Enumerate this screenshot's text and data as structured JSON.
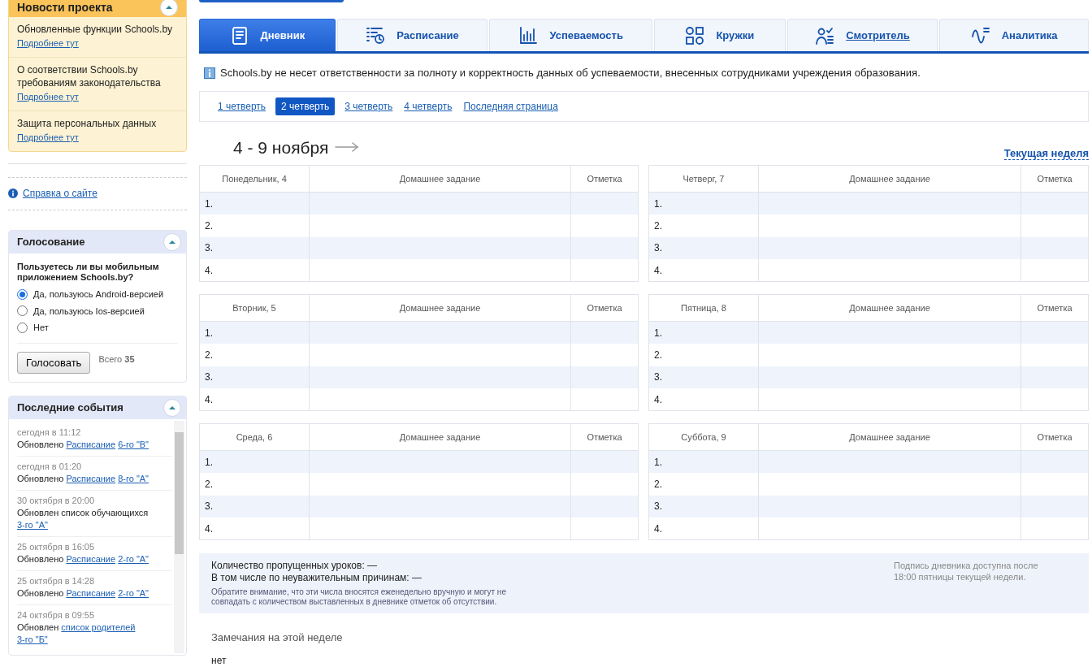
{
  "sidebar": {
    "news": {
      "title": "Новости проекта",
      "expanded": true,
      "items": [
        {
          "text": "Обновленные функции Schools.by",
          "link": "Подробнее тут"
        },
        {
          "text": "О соответствии Schools.by требованиям законодательства",
          "link": "Подробнее тут"
        },
        {
          "text": "Защита персональных данных",
          "link": "Подробнее тут"
        }
      ]
    },
    "help_link": "Справка о сайте",
    "poll": {
      "title": "Голосование",
      "expanded": true,
      "question": "Пользуетесь ли вы мобильным приложением Schools.by?",
      "options": [
        {
          "label": "Да, пользуюсь Android-версией",
          "selected": true
        },
        {
          "label": "Да, пользуюсь Ios-версией",
          "selected": false
        },
        {
          "label": "Нет",
          "selected": false
        }
      ],
      "button": "Голосовать",
      "total": "Всего **35**"
    },
    "events": {
      "title": "Последние события",
      "expanded": true,
      "items": [
        {
          "time": "сегодня в 11:12",
          "prefix": "Обновлено",
          "links": [
            "Расписание",
            "6-го \"В\""
          ]
        },
        {
          "time": "сегодня в 01:20",
          "prefix": "Обновлено",
          "links": [
            "Расписание",
            "8-го \"А\""
          ]
        },
        {
          "time": "30 октября в 20:00",
          "prefix": "Обновлен список обучающихся",
          "links": [
            "3-го \"А\""
          ]
        },
        {
          "time": "25 октября в 16:05",
          "prefix": "Обновлено",
          "links": [
            "Расписание",
            "2-го \"А\""
          ]
        },
        {
          "time": "25 октября в 14:28",
          "prefix": "Обновлено",
          "links": [
            "Расписание",
            "2-го \"А\""
          ]
        },
        {
          "time": "24 октября в 09:55",
          "prefix": "Обновлен",
          "links": [
            "список родителей",
            "3-го \"Б\""
          ]
        }
      ]
    }
  },
  "tabs": [
    {
      "label": "Дневник",
      "selected": true,
      "underlined": false
    },
    {
      "label": "Расписание",
      "selected": false,
      "underlined": false
    },
    {
      "label": "Успеваемость",
      "selected": false,
      "underlined": false
    },
    {
      "label": "Кружки",
      "selected": false,
      "underlined": false
    },
    {
      "label": "Смотритель",
      "selected": false,
      "underlined": true
    },
    {
      "label": "Аналитика",
      "selected": false,
      "underlined": false
    }
  ],
  "notice": "Schools.by не несет ответственности за полноту и корректность данных об успеваемости, внесенных сотрудниками учреждения образования.",
  "quarters": [
    {
      "label": "1 четверть",
      "selected": false
    },
    {
      "label": "2 четверть",
      "selected": true
    },
    {
      "label": "3 четверть",
      "selected": false
    },
    {
      "label": "4 четверть",
      "selected": false
    },
    {
      "label": "Последняя страница",
      "selected": false
    }
  ],
  "week": {
    "title": "4 - 9 ноября",
    "current_week": "Текущая неделя"
  },
  "days": [
    {
      "day": "Понедельник, 4",
      "homework": "Домашнее задание",
      "mark": "Отметка",
      "rows": [
        "1.",
        "2.",
        "3.",
        "4."
      ]
    },
    {
      "day": "Вторник, 5",
      "homework": "Домашнее задание",
      "mark": "Отметка",
      "rows": [
        "1.",
        "2.",
        "3.",
        "4."
      ]
    },
    {
      "day": "Среда, 6",
      "homework": "Домашнее задание",
      "mark": "Отметка",
      "rows": [
        "1.",
        "2.",
        "3.",
        "4."
      ]
    },
    {
      "day": "Четверг, 7",
      "homework": "Домашнее задание",
      "mark": "Отметка",
      "rows": [
        "1.",
        "2.",
        "3.",
        "4."
      ]
    },
    {
      "day": "Пятница, 8",
      "homework": "Домашнее задание",
      "mark": "Отметка",
      "rows": [
        "1.",
        "2.",
        "3.",
        "4."
      ]
    },
    {
      "day": "Суббота, 9",
      "homework": "Домашнее задание",
      "mark": "Отметка",
      "rows": [
        "1.",
        "2.",
        "3.",
        "4."
      ]
    }
  ],
  "summary": {
    "missed": "Количество пропущенных уроков: —",
    "unexcused": "В том числе по неуважительным причинам: —",
    "note": "Обратите внимание, что эти числа вносятся еженедельно вручную и могут не совпадать с количеством выставленных в дневнике отметок об отсутствии.",
    "signature": "Подпись дневника доступна после 18:00 пятницы текущей недели."
  },
  "remarks": {
    "title": "Замечания на этой неделе",
    "text": "нет"
  }
}
